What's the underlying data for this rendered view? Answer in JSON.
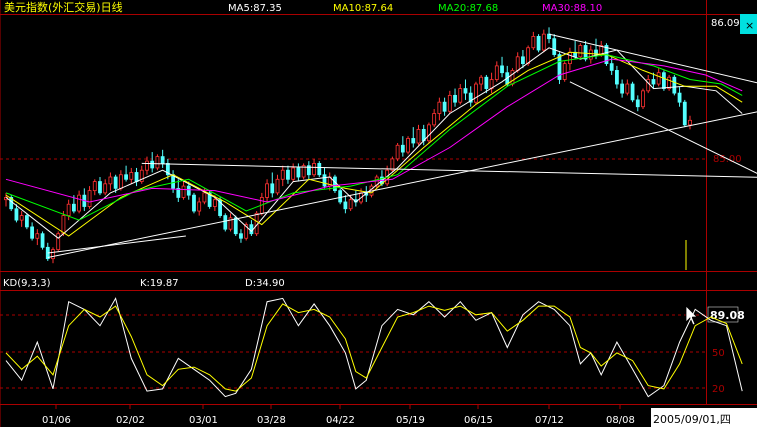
{
  "header": {
    "title": "美元指数(外汇交易)日线",
    "ma_labels": [
      {
        "text": "MA5:87.35",
        "color": "#ffffff"
      },
      {
        "text": "MA10:87.64",
        "color": "#ffff00"
      },
      {
        "text": "MA20:87.68",
        "color": "#00ff00"
      },
      {
        "text": "MA30:88.10",
        "color": "#ff00ff"
      }
    ],
    "title_color": "#ffff00"
  },
  "price_axis": {
    "top_value": "86.09",
    "mid_value": "85.00",
    "highlight_label": "89.08"
  },
  "kd_header": {
    "name": "KD(9,3,3)",
    "k": "K:19.87",
    "d": "D:34.90"
  },
  "kd_axis": {
    "levels": [
      "50",
      "20"
    ]
  },
  "date_axis": {
    "ticks": [
      "01/06",
      "02/02",
      "03/01",
      "03/28",
      "04/22",
      "05/19",
      "06/15",
      "07/12",
      "08/08"
    ],
    "current_date": "2005/09/01,四"
  },
  "colors": {
    "up": "#ff3232",
    "down": "#54ffff",
    "grid": "#aa0000",
    "k": "#ffffff",
    "d": "#ffff00",
    "ma5": "#ffffff",
    "ma10": "#ffff00",
    "ma20": "#00ff00",
    "ma30": "#ff00ff"
  },
  "chart_data": {
    "type": "candlestick",
    "ylim": [
      81.0,
      92.2
    ],
    "candles": [
      [
        84.1,
        84.4,
        83.8,
        84.2
      ],
      [
        84.2,
        84.3,
        83.6,
        83.7
      ],
      [
        83.7,
        83.9,
        83.1,
        83.2
      ],
      [
        83.2,
        83.6,
        82.9,
        83.4
      ],
      [
        83.4,
        83.5,
        82.8,
        82.9
      ],
      [
        82.9,
        83.1,
        82.3,
        82.4
      ],
      [
        82.4,
        82.8,
        82.1,
        82.6
      ],
      [
        82.6,
        82.7,
        81.9,
        82.0
      ],
      [
        82.0,
        82.2,
        81.4,
        81.5
      ],
      [
        81.5,
        82.0,
        81.3,
        81.9
      ],
      [
        81.9,
        82.7,
        81.8,
        82.6
      ],
      [
        82.6,
        83.6,
        82.5,
        83.4
      ],
      [
        83.4,
        84.1,
        83.2,
        83.9
      ],
      [
        83.9,
        84.3,
        83.5,
        83.6
      ],
      [
        83.6,
        84.5,
        83.5,
        84.3
      ],
      [
        84.3,
        84.6,
        83.6,
        83.8
      ],
      [
        83.8,
        84.7,
        83.7,
        84.5
      ],
      [
        84.5,
        85.0,
        84.3,
        84.9
      ],
      [
        84.9,
        85.1,
        84.3,
        84.4
      ],
      [
        84.4,
        85.0,
        84.3,
        84.8
      ],
      [
        84.8,
        85.3,
        84.5,
        85.1
      ],
      [
        85.1,
        85.2,
        84.4,
        84.6
      ],
      [
        84.6,
        85.4,
        84.5,
        85.2
      ],
      [
        85.2,
        85.6,
        84.9,
        85.0
      ],
      [
        85.0,
        85.5,
        84.8,
        85.3
      ],
      [
        85.3,
        85.5,
        84.7,
        84.9
      ],
      [
        84.9,
        85.6,
        84.8,
        85.4
      ],
      [
        85.4,
        86.0,
        85.2,
        85.8
      ],
      [
        85.8,
        86.2,
        85.3,
        85.5
      ],
      [
        85.5,
        86.1,
        85.4,
        86.0
      ],
      [
        86.0,
        86.3,
        85.5,
        85.7
      ],
      [
        85.7,
        85.9,
        85.0,
        85.2
      ],
      [
        85.2,
        85.4,
        84.4,
        84.6
      ],
      [
        84.6,
        85.0,
        84.0,
        84.2
      ],
      [
        84.2,
        84.9,
        84.1,
        84.7
      ],
      [
        84.7,
        84.9,
        84.1,
        84.3
      ],
      [
        84.3,
        84.4,
        83.5,
        83.6
      ],
      [
        83.6,
        84.2,
        83.4,
        84.0
      ],
      [
        84.0,
        84.6,
        83.9,
        84.4
      ],
      [
        84.4,
        84.5,
        83.7,
        83.8
      ],
      [
        83.8,
        84.3,
        83.6,
        84.1
      ],
      [
        84.1,
        84.2,
        83.3,
        83.4
      ],
      [
        83.4,
        83.5,
        82.7,
        82.8
      ],
      [
        82.8,
        83.5,
        82.7,
        83.3
      ],
      [
        83.3,
        83.4,
        82.5,
        82.6
      ],
      [
        82.6,
        82.8,
        82.2,
        82.4
      ],
      [
        82.4,
        83.1,
        82.3,
        83.0
      ],
      [
        83.0,
        83.2,
        82.5,
        82.6
      ],
      [
        82.6,
        83.6,
        82.5,
        83.5
      ],
      [
        83.5,
        84.4,
        83.4,
        84.2
      ],
      [
        84.2,
        85.0,
        84.0,
        84.8
      ],
      [
        84.8,
        85.3,
        84.2,
        84.4
      ],
      [
        84.4,
        85.2,
        84.3,
        85.0
      ],
      [
        85.0,
        85.6,
        84.7,
        85.4
      ],
      [
        85.4,
        85.6,
        84.8,
        85.0
      ],
      [
        85.0,
        85.7,
        84.9,
        85.5
      ],
      [
        85.5,
        85.7,
        84.9,
        85.1
      ],
      [
        85.1,
        85.7,
        85.0,
        85.6
      ],
      [
        85.6,
        85.8,
        85.0,
        85.2
      ],
      [
        85.2,
        85.9,
        85.1,
        85.7
      ],
      [
        85.7,
        85.8,
        85.1,
        85.2
      ],
      [
        85.2,
        85.5,
        84.6,
        84.7
      ],
      [
        84.7,
        85.3,
        84.5,
        85.1
      ],
      [
        85.1,
        85.2,
        84.4,
        84.5
      ],
      [
        84.5,
        84.6,
        83.9,
        84.0
      ],
      [
        84.0,
        84.3,
        83.5,
        83.7
      ],
      [
        83.7,
        84.3,
        83.6,
        84.1
      ],
      [
        84.1,
        84.5,
        83.8,
        84.0
      ],
      [
        84.0,
        84.6,
        83.9,
        84.4
      ],
      [
        84.4,
        84.7,
        84.0,
        84.3
      ],
      [
        84.3,
        84.8,
        84.2,
        84.7
      ],
      [
        84.7,
        85.2,
        84.6,
        85.1
      ],
      [
        85.1,
        85.4,
        84.7,
        84.8
      ],
      [
        84.8,
        85.6,
        84.7,
        85.4
      ],
      [
        85.4,
        86.0,
        85.3,
        85.9
      ],
      [
        85.9,
        86.6,
        85.8,
        86.5
      ],
      [
        86.5,
        86.9,
        86.0,
        86.2
      ],
      [
        86.2,
        86.9,
        86.1,
        86.8
      ],
      [
        86.8,
        87.3,
        86.4,
        86.6
      ],
      [
        86.6,
        87.4,
        86.5,
        87.2
      ],
      [
        87.2,
        87.4,
        86.5,
        86.7
      ],
      [
        86.7,
        87.5,
        86.6,
        87.4
      ],
      [
        87.4,
        88.1,
        87.3,
        87.9
      ],
      [
        87.9,
        88.6,
        87.6,
        88.4
      ],
      [
        88.4,
        88.6,
        87.8,
        88.0
      ],
      [
        88.0,
        88.9,
        87.9,
        88.7
      ],
      [
        88.7,
        89.0,
        88.2,
        88.4
      ],
      [
        88.4,
        89.2,
        88.3,
        89.0
      ],
      [
        89.0,
        89.4,
        88.5,
        88.8
      ],
      [
        88.8,
        89.1,
        88.2,
        88.4
      ],
      [
        88.4,
        89.3,
        88.3,
        89.2
      ],
      [
        89.2,
        89.6,
        88.9,
        89.5
      ],
      [
        89.5,
        89.6,
        88.8,
        89.0
      ],
      [
        89.0,
        89.7,
        88.8,
        89.4
      ],
      [
        89.4,
        90.2,
        89.3,
        90.0
      ],
      [
        90.0,
        90.4,
        89.5,
        89.7
      ],
      [
        89.7,
        90.0,
        89.1,
        89.2
      ],
      [
        89.2,
        89.9,
        89.1,
        89.8
      ],
      [
        89.8,
        90.6,
        89.7,
        90.4
      ],
      [
        90.4,
        90.7,
        89.9,
        90.1
      ],
      [
        90.1,
        90.9,
        90.0,
        90.8
      ],
      [
        90.8,
        91.5,
        90.7,
        91.3
      ],
      [
        91.3,
        91.4,
        90.6,
        90.7
      ],
      [
        90.7,
        91.6,
        90.6,
        91.4
      ],
      [
        91.4,
        91.7,
        91.0,
        91.2
      ],
      [
        91.2,
        91.4,
        90.4,
        90.5
      ],
      [
        90.5,
        90.6,
        89.2,
        89.4
      ],
      [
        89.4,
        90.2,
        89.3,
        90.1
      ],
      [
        90.1,
        90.8,
        89.8,
        90.6
      ],
      [
        90.6,
        91.1,
        90.3,
        90.4
      ],
      [
        90.4,
        91.0,
        90.3,
        90.9
      ],
      [
        90.9,
        91.1,
        90.2,
        90.3
      ],
      [
        90.3,
        90.9,
        90.1,
        90.7
      ],
      [
        90.7,
        91.2,
        90.3,
        90.5
      ],
      [
        90.5,
        91.1,
        90.4,
        90.9
      ],
      [
        90.9,
        91.0,
        90.0,
        90.1
      ],
      [
        90.1,
        90.4,
        89.6,
        89.8
      ],
      [
        89.8,
        90.0,
        89.0,
        89.2
      ],
      [
        89.2,
        89.4,
        88.6,
        88.8
      ],
      [
        88.8,
        89.4,
        88.7,
        89.2
      ],
      [
        89.2,
        89.3,
        88.4,
        88.5
      ],
      [
        88.5,
        88.7,
        88.0,
        88.2
      ],
      [
        88.2,
        89.0,
        88.1,
        88.9
      ],
      [
        88.9,
        89.6,
        88.8,
        89.4
      ],
      [
        89.4,
        89.7,
        89.0,
        89.2
      ],
      [
        89.2,
        89.9,
        89.1,
        89.7
      ],
      [
        89.7,
        89.8,
        88.9,
        89.0
      ],
      [
        89.0,
        89.6,
        88.9,
        89.5
      ],
      [
        89.5,
        89.6,
        88.7,
        88.8
      ],
      [
        88.8,
        89.1,
        88.2,
        88.4
      ],
      [
        88.4,
        88.5,
        87.3,
        87.4
      ],
      [
        87.4,
        87.8,
        87.2,
        87.6
      ]
    ],
    "ma": {
      "MA5": [
        [
          0,
          84.2
        ],
        [
          10,
          82.4
        ],
        [
          20,
          84.4
        ],
        [
          30,
          85.4
        ],
        [
          40,
          84.2
        ],
        [
          47,
          82.7
        ],
        [
          55,
          84.9
        ],
        [
          62,
          85.1
        ],
        [
          67,
          84.0
        ],
        [
          75,
          85.5
        ],
        [
          85,
          87.9
        ],
        [
          95,
          89.3
        ],
        [
          104,
          90.8
        ],
        [
          110,
          90.3
        ],
        [
          117,
          90.7
        ],
        [
          124,
          89.0
        ],
        [
          130,
          89.1
        ],
        [
          136,
          88.9
        ],
        [
          141,
          87.9
        ]
      ],
      "MA10": [
        [
          0,
          84.3
        ],
        [
          12,
          82.5
        ],
        [
          22,
          84.2
        ],
        [
          32,
          85.2
        ],
        [
          42,
          84.0
        ],
        [
          49,
          83.0
        ],
        [
          58,
          85.0
        ],
        [
          65,
          84.6
        ],
        [
          70,
          84.4
        ],
        [
          80,
          86.4
        ],
        [
          90,
          88.3
        ],
        [
          100,
          89.8
        ],
        [
          108,
          90.6
        ],
        [
          115,
          90.5
        ],
        [
          122,
          89.8
        ],
        [
          130,
          89.1
        ],
        [
          136,
          89.1
        ],
        [
          141,
          88.4
        ]
      ],
      "MA20": [
        [
          0,
          84.4
        ],
        [
          14,
          83.2
        ],
        [
          25,
          84.5
        ],
        [
          35,
          85.0
        ],
        [
          46,
          83.6
        ],
        [
          55,
          84.4
        ],
        [
          66,
          84.7
        ],
        [
          75,
          85.2
        ],
        [
          85,
          87.2
        ],
        [
          96,
          89.1
        ],
        [
          106,
          90.2
        ],
        [
          115,
          90.5
        ],
        [
          124,
          90.0
        ],
        [
          131,
          89.4
        ],
        [
          137,
          89.2
        ],
        [
          141,
          88.7
        ]
      ],
      "MA30": [
        [
          0,
          85.0
        ],
        [
          16,
          84.0
        ],
        [
          28,
          84.6
        ],
        [
          40,
          84.5
        ],
        [
          50,
          84.0
        ],
        [
          62,
          84.7
        ],
        [
          74,
          85.0
        ],
        [
          85,
          86.4
        ],
        [
          96,
          88.2
        ],
        [
          106,
          89.6
        ],
        [
          116,
          90.3
        ],
        [
          126,
          90.0
        ],
        [
          134,
          89.6
        ],
        [
          141,
          88.9
        ]
      ]
    },
    "trendlines": [
      [
        [
          8,
          81.55
        ],
        [
          142,
          88.05
        ]
      ],
      [
        [
          26,
          85.7
        ],
        [
          142,
          85.08
        ]
      ],
      [
        [
          104,
          91.4
        ],
        [
          142,
          89.17
        ]
      ],
      [
        [
          108,
          89.3
        ],
        [
          142,
          85.08
        ]
      ],
      [
        [
          8,
          81.75
        ],
        [
          31,
          82.5
        ]
      ]
    ],
    "kd": {
      "ylim": [
        0,
        100
      ],
      "K": [
        [
          0,
          38
        ],
        [
          3,
          20
        ],
        [
          6,
          55
        ],
        [
          9,
          12
        ],
        [
          12,
          92
        ],
        [
          15,
          85
        ],
        [
          18,
          70
        ],
        [
          21,
          95
        ],
        [
          24,
          40
        ],
        [
          27,
          10
        ],
        [
          30,
          12
        ],
        [
          33,
          40
        ],
        [
          36,
          30
        ],
        [
          39,
          20
        ],
        [
          42,
          5
        ],
        [
          44,
          8
        ],
        [
          47,
          30
        ],
        [
          50,
          92
        ],
        [
          53,
          95
        ],
        [
          56,
          70
        ],
        [
          59,
          90
        ],
        [
          62,
          70
        ],
        [
          65,
          45
        ],
        [
          67,
          12
        ],
        [
          69,
          20
        ],
        [
          72,
          70
        ],
        [
          75,
          85
        ],
        [
          78,
          80
        ],
        [
          81,
          92
        ],
        [
          84,
          78
        ],
        [
          87,
          92
        ],
        [
          90,
          75
        ],
        [
          93,
          82
        ],
        [
          96,
          50
        ],
        [
          99,
          80
        ],
        [
          102,
          92
        ],
        [
          105,
          85
        ],
        [
          108,
          70
        ],
        [
          110,
          35
        ],
        [
          112,
          45
        ],
        [
          114,
          25
        ],
        [
          117,
          55
        ],
        [
          120,
          30
        ],
        [
          123,
          5
        ],
        [
          126,
          15
        ],
        [
          129,
          55
        ],
        [
          132,
          85
        ],
        [
          135,
          75
        ],
        [
          138,
          70
        ],
        [
          141,
          10
        ]
      ],
      "D": [
        [
          0,
          45
        ],
        [
          3,
          30
        ],
        [
          6,
          42
        ],
        [
          9,
          25
        ],
        [
          12,
          70
        ],
        [
          15,
          85
        ],
        [
          18,
          78
        ],
        [
          21,
          88
        ],
        [
          24,
          60
        ],
        [
          27,
          25
        ],
        [
          30,
          15
        ],
        [
          33,
          30
        ],
        [
          36,
          32
        ],
        [
          39,
          25
        ],
        [
          42,
          12
        ],
        [
          44,
          10
        ],
        [
          47,
          22
        ],
        [
          50,
          70
        ],
        [
          53,
          90
        ],
        [
          56,
          82
        ],
        [
          59,
          85
        ],
        [
          62,
          78
        ],
        [
          65,
          58
        ],
        [
          67,
          28
        ],
        [
          69,
          22
        ],
        [
          72,
          50
        ],
        [
          75,
          78
        ],
        [
          78,
          82
        ],
        [
          81,
          88
        ],
        [
          84,
          84
        ],
        [
          87,
          88
        ],
        [
          90,
          80
        ],
        [
          93,
          82
        ],
        [
          96,
          65
        ],
        [
          99,
          75
        ],
        [
          102,
          88
        ],
        [
          105,
          88
        ],
        [
          108,
          78
        ],
        [
          110,
          50
        ],
        [
          112,
          45
        ],
        [
          114,
          33
        ],
        [
          117,
          45
        ],
        [
          120,
          38
        ],
        [
          123,
          15
        ],
        [
          126,
          12
        ],
        [
          129,
          35
        ],
        [
          132,
          70
        ],
        [
          135,
          78
        ],
        [
          138,
          72
        ],
        [
          141,
          35
        ]
      ]
    }
  }
}
